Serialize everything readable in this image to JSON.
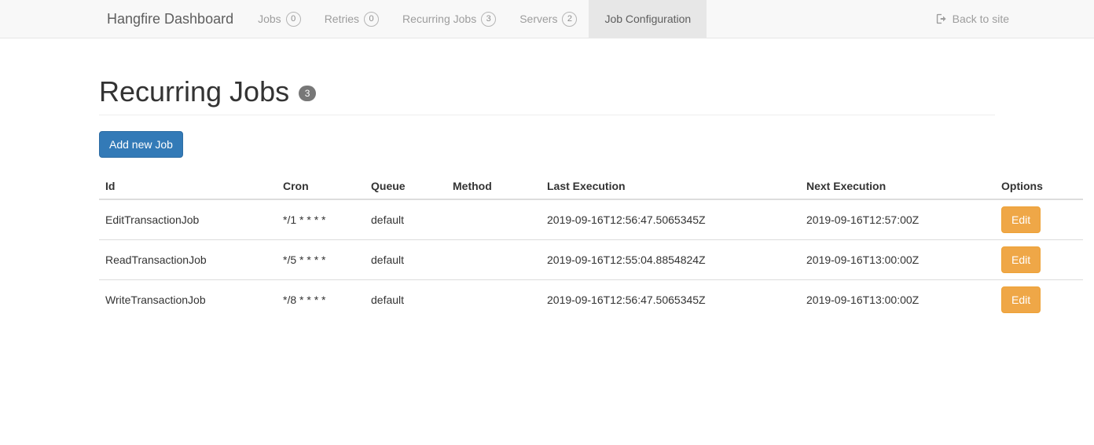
{
  "navbar": {
    "brand": "Hangfire Dashboard",
    "items": [
      {
        "label": "Jobs",
        "badge": "0",
        "active": false
      },
      {
        "label": "Retries",
        "badge": "0",
        "active": false
      },
      {
        "label": "Recurring Jobs",
        "badge": "3",
        "active": false
      },
      {
        "label": "Servers",
        "badge": "2",
        "active": false
      },
      {
        "label": "Job Configuration",
        "badge": null,
        "active": true
      }
    ],
    "back_link": {
      "label": "Back to site",
      "icon": "sign-out-icon"
    }
  },
  "page": {
    "title": "Recurring Jobs",
    "title_badge": "3",
    "add_button": "Add new Job"
  },
  "table": {
    "headers": {
      "id": "Id",
      "cron": "Cron",
      "queue": "Queue",
      "method": "Method",
      "last_execution": "Last Execution",
      "next_execution": "Next Execution",
      "options": "Options"
    },
    "rows": [
      {
        "id": "EditTransactionJob",
        "cron": "*/1 * * * *",
        "queue": "default",
        "method": "",
        "last_execution": "2019-09-16T12:56:47.5065345Z",
        "next_execution": "2019-09-16T12:57:00Z",
        "edit_label": "Edit"
      },
      {
        "id": "ReadTransactionJob",
        "cron": "*/5 * * * *",
        "queue": "default",
        "method": "",
        "last_execution": "2019-09-16T12:55:04.8854824Z",
        "next_execution": "2019-09-16T13:00:00Z",
        "edit_label": "Edit"
      },
      {
        "id": "WriteTransactionJob",
        "cron": "*/8 * * * *",
        "queue": "default",
        "method": "",
        "last_execution": "2019-09-16T12:56:47.5065345Z",
        "next_execution": "2019-09-16T13:00:00Z",
        "edit_label": "Edit"
      }
    ]
  },
  "colors": {
    "navbar_bg": "#f8f8f8",
    "navbar_active_bg": "#e7e7e7",
    "primary": "#337ab7",
    "warning": "#efa747",
    "badge_solid": "#777777",
    "text": "#333333",
    "muted": "#9d9d9d"
  }
}
